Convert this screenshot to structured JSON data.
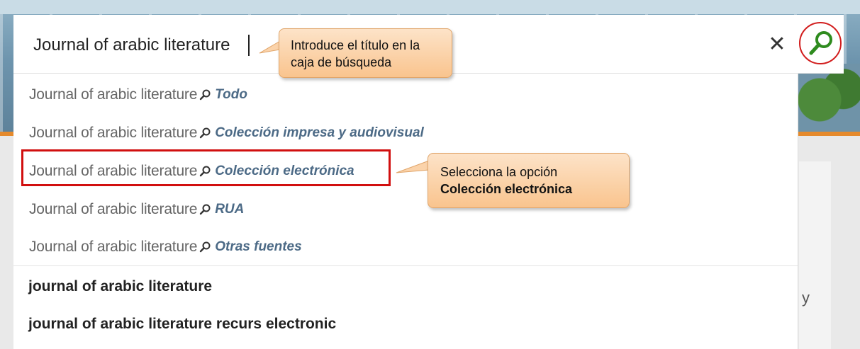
{
  "search": {
    "value": "Journal of arabic literature",
    "clear_icon": "close-icon",
    "search_icon": "search-icon"
  },
  "scoped_suggestions": [
    {
      "query": "Journal of arabic literature",
      "scope": "Todo"
    },
    {
      "query": "Journal of arabic literature",
      "scope": "Colección impresa y audiovisual"
    },
    {
      "query": "Journal of arabic literature",
      "scope": "Colección electrónica"
    },
    {
      "query": "Journal of arabic literature",
      "scope": "RUA"
    },
    {
      "query": "Journal of arabic literature",
      "scope": "Otras fuentes"
    }
  ],
  "term_suggestions": [
    "journal of arabic literature",
    "journal of arabic literature recurs electronic"
  ],
  "callouts": {
    "search_box": "Introduce el título en la caja de búsqueda",
    "select_option_line1": "Selecciona la opción",
    "select_option_line2": "Colección electrónica"
  },
  "background_fragment": "y",
  "colors": {
    "highlight": "#d10f0f",
    "search_button_ring": "#d21e1e",
    "search_icon": "#2e8b1e",
    "scope_text": "#4c6a86",
    "callout_fill": "#f9c48e",
    "banner_accent": "#e58a2c"
  }
}
